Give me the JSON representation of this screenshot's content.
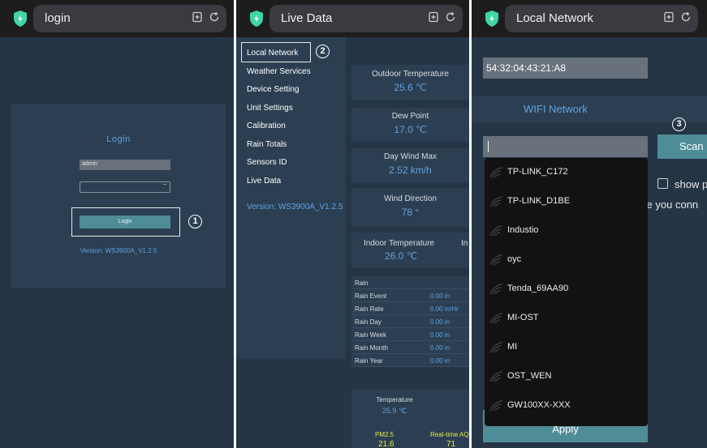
{
  "colors": {
    "accent": "#5ea2e2",
    "button": "#4e8c97",
    "panel_bg": "#253546",
    "card_bg": "#2c3f52",
    "highlight_yellow": "#e8e84a"
  },
  "screens": [
    {
      "title": "login",
      "card": {
        "heading": "Login",
        "username_value": "admin",
        "password_value": "",
        "login_button": "Login",
        "step_badge": "1",
        "version": "Version: WS3900A_V1.2.5"
      }
    },
    {
      "title": "Live Data",
      "menu": {
        "items": [
          "Local Network",
          "Weather Services",
          "Device Setting",
          "Unit Settings",
          "Calibration",
          "Rain Totals",
          "Sensors ID",
          "Live Data"
        ],
        "step_badge": "2",
        "version": "Version: WS3900A_V1.2.5"
      },
      "cards": {
        "outdoor_temp": {
          "label": "Outdoor Temperature",
          "value": "25.6 ℃"
        },
        "dew_point": {
          "label": "Dew Point",
          "value": "17.0 ℃"
        },
        "day_wind_max": {
          "label": "Day Wind Max",
          "value": "2.52 km/h"
        },
        "wind_direction": {
          "label": "Wind Direction",
          "value": "78 °"
        },
        "indoor_temp": {
          "label": "Indoor Temperature",
          "value": "26.0 ℃",
          "cut_label": "In"
        }
      },
      "rain": {
        "header": "Rain",
        "rows": [
          {
            "k": "Rain Event",
            "v": "0.00 in"
          },
          {
            "k": "Rain Rate",
            "v": "0.00 in/Hr"
          },
          {
            "k": "Rain Day",
            "v": "0.00 in"
          },
          {
            "k": "Rain Week",
            "v": "0.00 in"
          },
          {
            "k": "Rain Month",
            "v": "0.00 in"
          },
          {
            "k": "Rain Year",
            "v": "0.00 in"
          }
        ]
      },
      "bottom": {
        "temp_label": "Temperature",
        "temp_value": "25.9 ℃",
        "pm_label": "PM2.5",
        "pm_value": "21.6",
        "aq_label": "Real-time AQ",
        "aq_value": "71"
      }
    },
    {
      "title": "Local Network",
      "mac": "54:32:04:43:21:A8",
      "wifi_title": "WIFI Network",
      "ssid_value": "",
      "scan_button": "Scan",
      "step_badge": "3",
      "show_password_label": "show p",
      "ensure_label": "ure you conn",
      "apply_button": "Apply",
      "networks": [
        "TP-LINK_C172",
        "TP-LINK_D1BE",
        "Industio",
        "oyc",
        "Tenda_69AA90",
        "MI-OST",
        "MI",
        "OST_WEN",
        "GW100XX-XXX"
      ]
    }
  ]
}
